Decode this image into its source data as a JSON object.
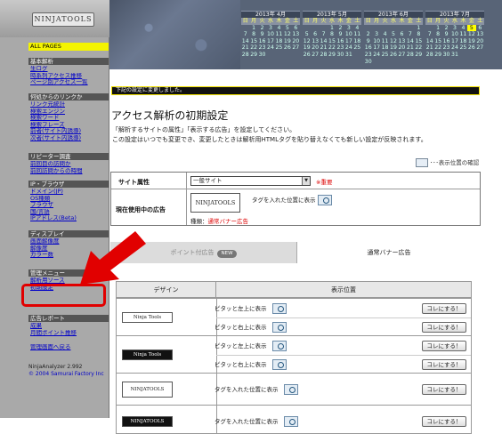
{
  "logo": {
    "text": "NINJATOOLS"
  },
  "sidebar": {
    "all_pages": "ALL PAGES",
    "sections": [
      {
        "header": "基本解析",
        "items": [
          "生ログ",
          "時系列アクセス推移",
          "ページ別アクセス一覧"
        ]
      },
      {
        "header": "何処からのリンクか",
        "items": [
          "リンク元統計",
          "検索エンジン",
          "検索ワード",
          "検索フレーズ",
          "前者(サイト内誘導)",
          "次者(サイト内誘導)"
        ]
      },
      {
        "header": "リピーター調査",
        "items": [
          "前回目の訪問か",
          "前回訪問からの時間"
        ]
      },
      {
        "header": "IP・ブラウザ",
        "items": [
          "ドメイン(JP)",
          "OS種類",
          "ブラウザ",
          "国/言語",
          "IPアドレス(Beta)"
        ]
      },
      {
        "header": "ディスプレイ",
        "items": [
          "画面解像度",
          "解像度",
          "カラー数"
        ]
      },
      {
        "header": "管理メニュー",
        "items": [
          "解析用ソース",
          "初期設定",
          "解析ページ設定"
        ]
      },
      {
        "header": "広告レポート",
        "items": [
          "成果",
          "月間ポイント推移"
        ]
      },
      {
        "header": "",
        "items": [
          "管理画面へ戻る"
        ]
      }
    ],
    "version": "NinjaAnalyzer 2.992",
    "copyright": "© 2004 Samurai Factory Inc"
  },
  "calendars": [
    {
      "title": "2013年 4月",
      "weekdays": [
        "日",
        "月",
        "火",
        "水",
        "木",
        "金",
        "土"
      ],
      "days": [
        "",
        "1",
        "2",
        "3",
        "4",
        "5",
        "6",
        "7",
        "8",
        "9",
        "10",
        "11",
        "12",
        "13",
        "14",
        "15",
        "16",
        "17",
        "18",
        "19",
        "20",
        "21",
        "22",
        "23",
        "24",
        "25",
        "26",
        "27",
        "28",
        "29",
        "30",
        "",
        "",
        "",
        ""
      ]
    },
    {
      "title": "2013年 5月",
      "weekdays": [
        "日",
        "月",
        "火",
        "水",
        "木",
        "金",
        "土"
      ],
      "days": [
        "",
        "",
        "",
        "1",
        "2",
        "3",
        "4",
        "5",
        "6",
        "7",
        "8",
        "9",
        "10",
        "11",
        "12",
        "13",
        "14",
        "15",
        "16",
        "17",
        "18",
        "19",
        "20",
        "21",
        "22",
        "23",
        "24",
        "25",
        "26",
        "27",
        "28",
        "29",
        "30",
        "31",
        ""
      ]
    },
    {
      "title": "2013年 6月",
      "weekdays": [
        "日",
        "月",
        "火",
        "水",
        "木",
        "金",
        "土"
      ],
      "days": [
        "",
        "",
        "",
        "",
        "",
        "",
        "1",
        "2",
        "3",
        "4",
        "5",
        "6",
        "7",
        "8",
        "9",
        "10",
        "11",
        "12",
        "13",
        "14",
        "15",
        "16",
        "17",
        "18",
        "19",
        "20",
        "21",
        "22",
        "23",
        "24",
        "25",
        "26",
        "27",
        "28",
        "29",
        "30",
        "",
        "",
        "",
        "",
        "",
        ""
      ]
    },
    {
      "title": "2013年 7月",
      "weekdays": [
        "日",
        "月",
        "火",
        "水",
        "木",
        "金",
        "土"
      ],
      "days": [
        "",
        "1",
        "2",
        "3",
        "4",
        "5",
        "6",
        "7",
        "8",
        "9",
        "10",
        "11",
        "12",
        "13",
        "14",
        "15",
        "16",
        "17",
        "18",
        "19",
        "20",
        "21",
        "22",
        "23",
        "24",
        "25",
        "26",
        "27",
        "28",
        "29",
        "30",
        "31",
        "",
        "",
        ""
      ],
      "today": "5"
    }
  ],
  "info_bar": "下記の設定に変更しました。",
  "page_title": "アクセス解析の初期設定",
  "intro": [
    "「解析するサイトの属性」「表示する広告」を設定してください。",
    "この設定はいつでも変更でき、変更したときは解析用HTMLタグを貼り替えなくても新しい設定が反映されます。"
  ],
  "position_check": "･･･表示位置の確認",
  "settings": {
    "site_attr_label": "サイト属性",
    "site_attr_value": "一般サイト",
    "required": "※重要",
    "current_ad_label": "現在使用中の広告",
    "current_ad_img": "NINJATOOLS",
    "current_ad_type": "種類：",
    "current_ad_type_value": "通常バナー広告",
    "current_ad_pos": "タグを入れた位置に表示"
  },
  "tabs": {
    "points": "ポイント付広告",
    "new": "NEW",
    "normal": "通常バナー広告"
  },
  "ad_table": {
    "design_header": "デザイン",
    "position_header": "表示位置",
    "rows": [
      {
        "img": "Ninja Tools",
        "dark": false,
        "positions": [
          "ピタッと左上に表示",
          "ピタッと右上に表示"
        ],
        "button": "コレにする！"
      },
      {
        "img": "Ninja Tools",
        "dark": true,
        "positions": [
          "ピタッと左上に表示",
          "ピタッと右上に表示"
        ],
        "button": "コレにする！"
      },
      {
        "img": "NINJATOOLS",
        "dark": false,
        "positions": [
          "タグを入れた位置に表示"
        ],
        "button": "コレにする！"
      },
      {
        "img": "NINJATOOLS",
        "dark": true,
        "positions": [
          "タグを入れた位置に表示"
        ],
        "button": "コレにする！"
      }
    ]
  },
  "colors": {
    "highlight": "#e10000",
    "accent_yellow": "#f4f400",
    "link": "#0000c8"
  }
}
